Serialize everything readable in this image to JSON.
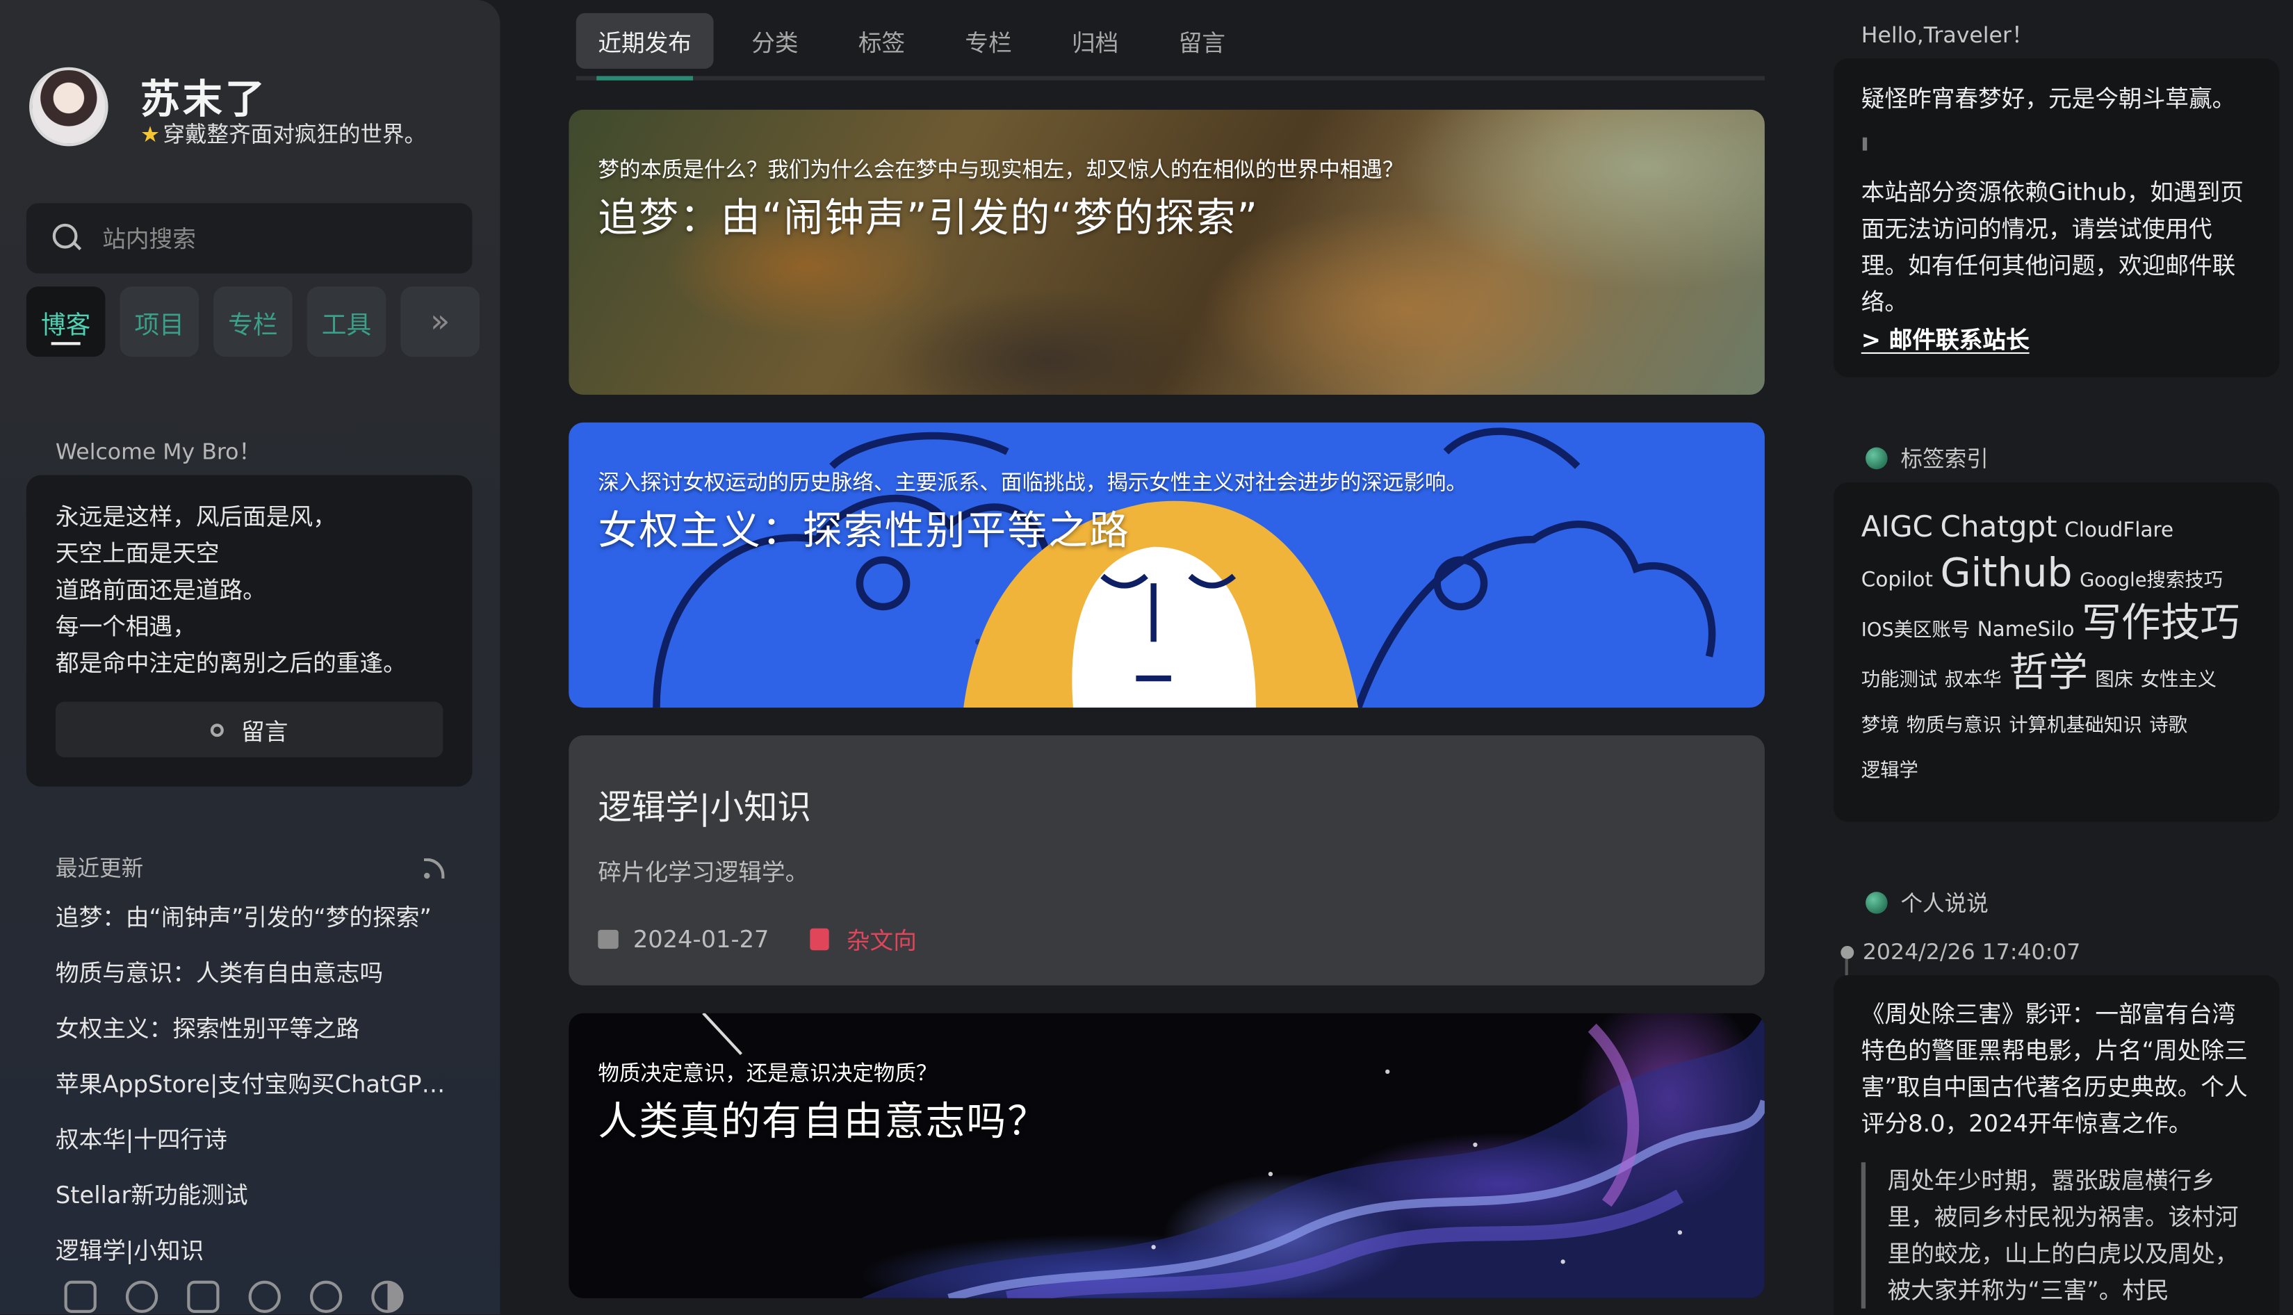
{
  "sidebar": {
    "site_name": "苏末了",
    "site_subtitle": "穿戴整齐面对疯狂的世界。",
    "search_placeholder": "站内搜索",
    "nav": [
      {
        "label": "博客"
      },
      {
        "label": "项目"
      },
      {
        "label": "专栏"
      },
      {
        "label": "工具"
      }
    ],
    "nav_more": "»",
    "welcome_title": "Welcome My Bro！",
    "welcome_lines": [
      "永远是这样，风后面是风，",
      "天空上面是天空",
      "道路前面还是道路。",
      "每一个相遇，",
      "都是命中注定的离别之后的重逢。"
    ],
    "message_button": "留言",
    "recent_title": "最近更新",
    "recent_items": [
      "追梦：由“闹钟声”引发的“梦的探索”",
      "物质与意识：人类有自由意志吗",
      "女权主义：探索性别平等之路",
      "苹果AppStore|支付宝购买ChatGPT Plus",
      "叔本华|十四行诗",
      "Stellar新功能测试",
      "逻辑学|小知识"
    ]
  },
  "tabs": [
    {
      "label": "近期发布"
    },
    {
      "label": "分类"
    },
    {
      "label": "标签"
    },
    {
      "label": "专栏"
    },
    {
      "label": "归档"
    },
    {
      "label": "留言"
    }
  ],
  "posts": [
    {
      "subtitle": "梦的本质是什么？我们为什么会在梦中与现实相左，却又惊人的在相似的世界中相遇？",
      "title": "追梦：由“闹钟声”引发的“梦的探索”"
    },
    {
      "subtitle": "深入探讨女权运动的历史脉络、主要派系、面临挑战，揭示女性主义对社会进步的深远影响。",
      "title": "女权主义：探索性别平等之路"
    },
    {
      "title": "逻辑学|小知识",
      "desc": "碎片化学习逻辑学。",
      "date": "2024-01-27",
      "category": "杂文向"
    },
    {
      "subtitle": "物质决定意识，还是意识决定物质？",
      "title": "人类真的有自由意志吗？"
    }
  ],
  "right": {
    "hello": "Hello,Traveler！",
    "quote": "疑怪昨宵春梦好，元是今朝斗草赢。",
    "notice": "本站部分资源依赖Github，如遇到页面无法访问的情况，请尝试使用代理。如有任何其他问题，欢迎邮件联络。",
    "notice_link": "> 邮件联系站长",
    "tags_title": "标签索引",
    "tags": [
      {
        "t": "AIGC",
        "s": "l"
      },
      {
        "t": "Chatgpt",
        "s": "l"
      },
      {
        "t": "CloudFlare",
        "s": "m"
      },
      {
        "t": "Copilot",
        "s": "m"
      },
      {
        "t": "Github",
        "s": "xl"
      },
      {
        "t": "Google搜索技巧",
        "s": "s"
      },
      {
        "t": "IOS美区账号",
        "s": "s"
      },
      {
        "t": "NameSilo",
        "s": "m"
      },
      {
        "t": "写作技巧",
        "s": "xl"
      },
      {
        "t": "功能测试",
        "s": "s"
      },
      {
        "t": "叔本华",
        "s": "s"
      },
      {
        "t": "哲学",
        "s": "xl"
      },
      {
        "t": "图床",
        "s": "s"
      },
      {
        "t": "女性主义",
        "s": "s"
      },
      {
        "t": "梦境",
        "s": "s"
      },
      {
        "t": "物质与意识",
        "s": "s"
      },
      {
        "t": "计算机基础知识",
        "s": "s"
      },
      {
        "t": "诗歌",
        "s": "s"
      },
      {
        "t": "逻辑学",
        "s": "s"
      }
    ],
    "talk_title": "个人说说",
    "talk_date": "2024/2/26 17:40:07",
    "talk_body": "《周处除三害》影评：一部富有台湾特色的警匪黑帮电影，片名“周处除三害”取自中国古代著名历史典故。个人评分8.0，2024开年惊喜之作。",
    "talk_quote": "周处年少时期，嚣张跋扈横行乡里，被同乡村民视为祸害。该村河里的蛟龙，山上的白虎以及周处，被大家并称为“三害”。村民"
  }
}
